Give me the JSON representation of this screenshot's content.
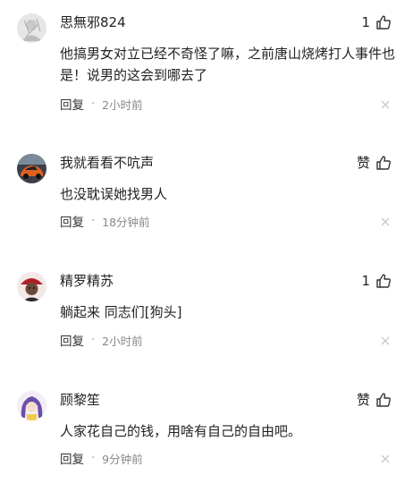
{
  "comments": [
    {
      "username": "思無邪824",
      "like_label": "1",
      "text": "他搞男女对立已经不奇怪了嘛，之前唐山烧烤打人事件也是！说男的这会到哪去了",
      "reply_label": "回复",
      "separator": "·",
      "time": "2小时前",
      "avatar_icon": "avatar-sketch"
    },
    {
      "username": "我就看看不吭声",
      "like_label": "赞",
      "text": "也没耽误她找男人",
      "reply_label": "回复",
      "separator": "·",
      "time": "18分钟前",
      "avatar_icon": "avatar-car"
    },
    {
      "username": "精罗精苏",
      "like_label": "1",
      "text": "躺起来 同志们[狗头]",
      "reply_label": "回复",
      "separator": "·",
      "time": "2小时前",
      "avatar_icon": "avatar-girl-red-hat"
    },
    {
      "username": "顾黎笙",
      "like_label": "赞",
      "text": "人家花自己的钱，用啥有自己的自由吧。",
      "reply_label": "回复",
      "separator": "·",
      "time": "9分钟前",
      "avatar_icon": "avatar-anime-purple"
    }
  ],
  "colors": {
    "text": "#222222",
    "meta": "#888888",
    "icon": "#333333",
    "close": "#c8c8c8"
  },
  "icons": {
    "like": "thumbs-up-icon",
    "close": "close-icon"
  }
}
